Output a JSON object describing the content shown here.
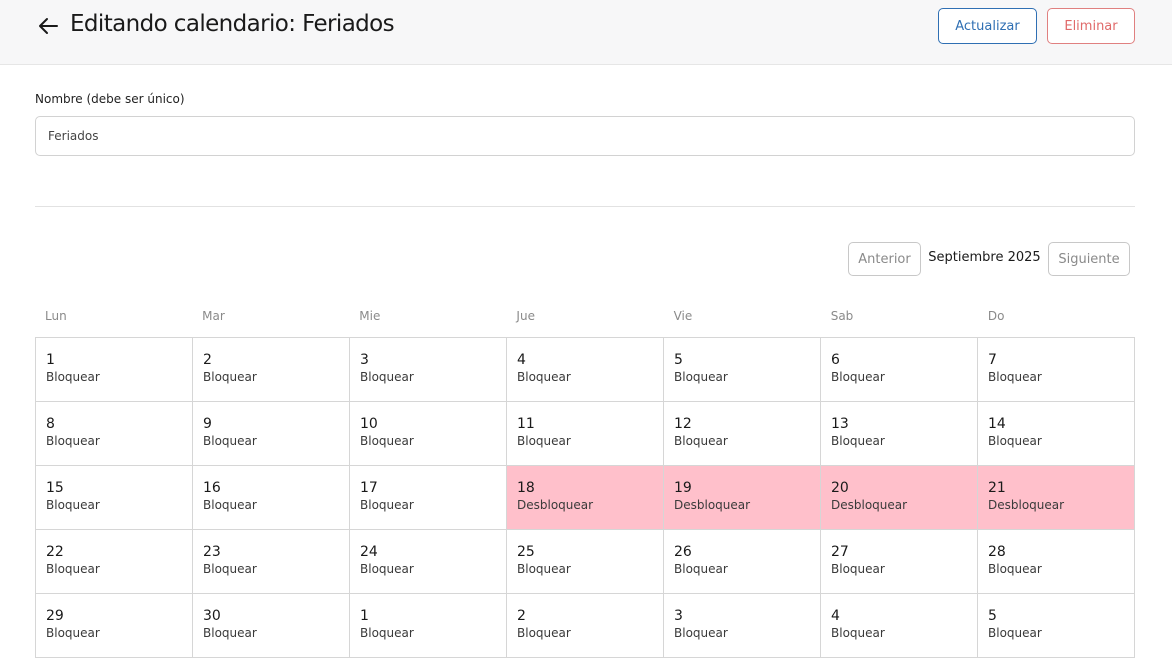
{
  "header": {
    "title": "Editando calendario: Feriados",
    "update_label": "Actualizar",
    "delete_label": "Eliminar"
  },
  "form": {
    "name_label": "Nombre (debe ser único)",
    "name_value": "Feriados"
  },
  "calendar": {
    "prev_label": "Anterior",
    "month_label": "Septiembre 2025",
    "next_label": "Siguiente",
    "weekdays": [
      "Lun",
      "Mar",
      "Mie",
      "Jue",
      "Vie",
      "Sab",
      "Do"
    ],
    "days": [
      {
        "day": "1",
        "action": "Bloquear",
        "blocked": false
      },
      {
        "day": "2",
        "action": "Bloquear",
        "blocked": false
      },
      {
        "day": "3",
        "action": "Bloquear",
        "blocked": false
      },
      {
        "day": "4",
        "action": "Bloquear",
        "blocked": false
      },
      {
        "day": "5",
        "action": "Bloquear",
        "blocked": false
      },
      {
        "day": "6",
        "action": "Bloquear",
        "blocked": false
      },
      {
        "day": "7",
        "action": "Bloquear",
        "blocked": false
      },
      {
        "day": "8",
        "action": "Bloquear",
        "blocked": false
      },
      {
        "day": "9",
        "action": "Bloquear",
        "blocked": false
      },
      {
        "day": "10",
        "action": "Bloquear",
        "blocked": false
      },
      {
        "day": "11",
        "action": "Bloquear",
        "blocked": false
      },
      {
        "day": "12",
        "action": "Bloquear",
        "blocked": false
      },
      {
        "day": "13",
        "action": "Bloquear",
        "blocked": false
      },
      {
        "day": "14",
        "action": "Bloquear",
        "blocked": false
      },
      {
        "day": "15",
        "action": "Bloquear",
        "blocked": false
      },
      {
        "day": "16",
        "action": "Bloquear",
        "blocked": false
      },
      {
        "day": "17",
        "action": "Bloquear",
        "blocked": false
      },
      {
        "day": "18",
        "action": "Desbloquear",
        "blocked": true
      },
      {
        "day": "19",
        "action": "Desbloquear",
        "blocked": true
      },
      {
        "day": "20",
        "action": "Desbloquear",
        "blocked": true
      },
      {
        "day": "21",
        "action": "Desbloquear",
        "blocked": true
      },
      {
        "day": "22",
        "action": "Bloquear",
        "blocked": false
      },
      {
        "day": "23",
        "action": "Bloquear",
        "blocked": false
      },
      {
        "day": "24",
        "action": "Bloquear",
        "blocked": false
      },
      {
        "day": "25",
        "action": "Bloquear",
        "blocked": false
      },
      {
        "day": "26",
        "action": "Bloquear",
        "blocked": false
      },
      {
        "day": "27",
        "action": "Bloquear",
        "blocked": false
      },
      {
        "day": "28",
        "action": "Bloquear",
        "blocked": false
      },
      {
        "day": "29",
        "action": "Bloquear",
        "blocked": false
      },
      {
        "day": "30",
        "action": "Bloquear",
        "blocked": false
      },
      {
        "day": "1",
        "action": "Bloquear",
        "blocked": false
      },
      {
        "day": "2",
        "action": "Bloquear",
        "blocked": false
      },
      {
        "day": "3",
        "action": "Bloquear",
        "blocked": false
      },
      {
        "day": "4",
        "action": "Bloquear",
        "blocked": false
      },
      {
        "day": "5",
        "action": "Bloquear",
        "blocked": false
      }
    ]
  },
  "colors": {
    "accent": "#2f6fb3",
    "danger": "#e06a6a",
    "blocked_bg": "#ffc0cb"
  }
}
